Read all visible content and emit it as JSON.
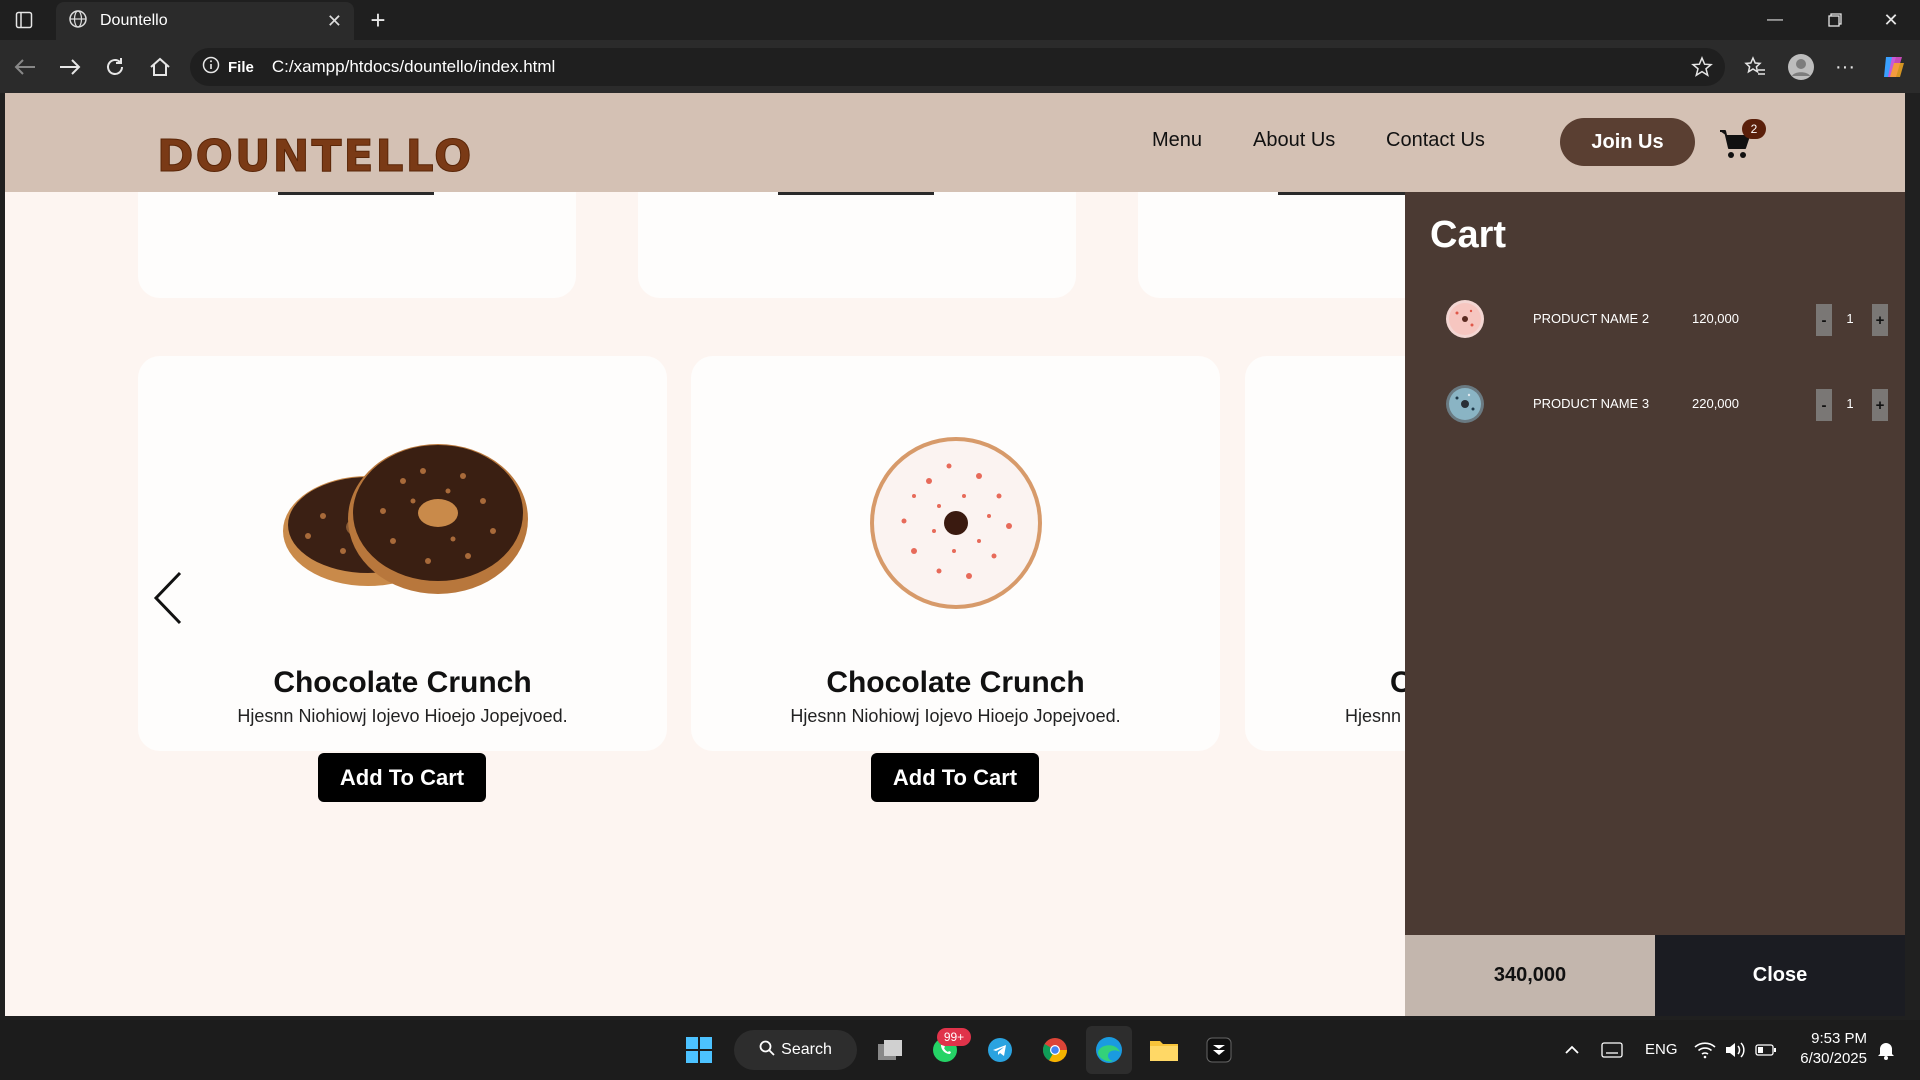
{
  "browser": {
    "tab_title": "Dountello",
    "file_label": "File",
    "url": "C:/xampp/htdocs/dountello/index.html"
  },
  "site": {
    "logo": "DOUNTELLO",
    "nav": [
      "Menu",
      "About Us",
      "Contact Us"
    ],
    "join_label": "Join Us",
    "cart_count": "2"
  },
  "products": [
    {
      "title": "Chocolate Crunch",
      "desc": "Hjesnn Niohiowj Iojevo Hioejo Jopejvoed.",
      "button": "Add To Cart",
      "image": "chocolate-donut"
    },
    {
      "title": "Chocolate Crunch",
      "desc": "Hjesnn Niohiowj Iojevo Hioejo Jopejvoed.",
      "button": "Add To Cart",
      "image": "strawberry-sprinkle-donut"
    },
    {
      "title": "C",
      "desc": "Hjesnn N",
      "button": "",
      "image": ""
    }
  ],
  "cart": {
    "title": "Cart",
    "items": [
      {
        "name": "PRODUCT NAME 2",
        "price": "120,000",
        "qty": "1",
        "minus": "-",
        "plus": "+"
      },
      {
        "name": "PRODUCT NAME 3",
        "price": "220,000",
        "qty": "1",
        "minus": "-",
        "plus": "+"
      }
    ],
    "total": "340,000",
    "close_label": "Close"
  },
  "taskbar": {
    "search_label": "Search",
    "whatsapp_badge": "99+",
    "language": "ENG",
    "time": "9:53 PM",
    "date": "6/30/2025"
  },
  "colors": {
    "header_bg": "#d4c1b4",
    "brand_brown": "#7a3a16",
    "cart_panel_bg": "#4b3a33",
    "join_button_bg": "#5a3f32"
  }
}
